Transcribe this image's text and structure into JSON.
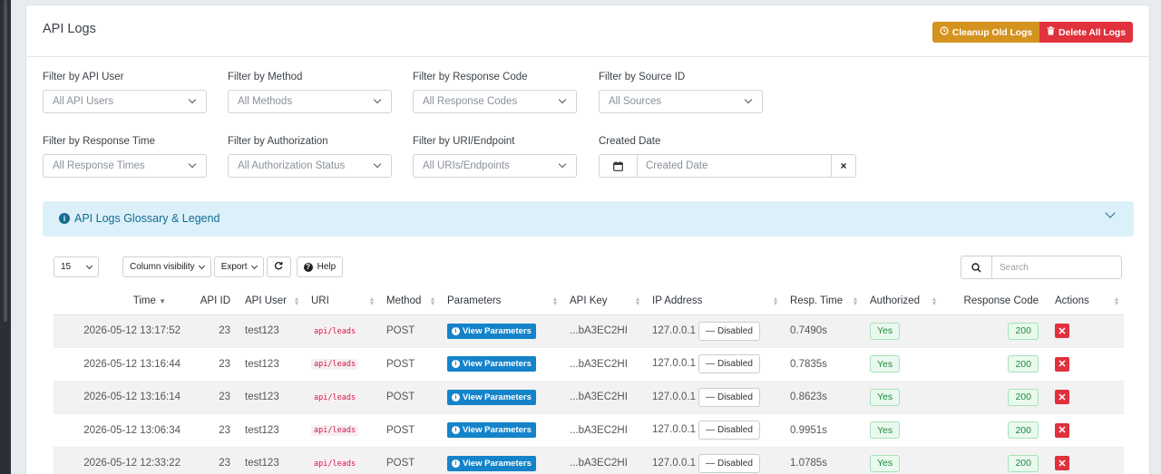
{
  "page": {
    "title": "API Logs",
    "cleanup_label": "Cleanup Old Logs",
    "delete_all_label": "Delete All Logs"
  },
  "filters": [
    {
      "label": "Filter by API User",
      "value": "All API Users"
    },
    {
      "label": "Filter by Method",
      "value": "All Methods"
    },
    {
      "label": "Filter by Response Code",
      "value": "All Response Codes"
    },
    {
      "label": "Filter by Source ID",
      "value": "All Sources"
    },
    {
      "label": "Filter by Response Time",
      "value": "All Response Times"
    },
    {
      "label": "Filter by Authorization",
      "value": "All Authorization Status"
    },
    {
      "label": "Filter by URI/Endpoint",
      "value": "All URIs/Endpoints"
    }
  ],
  "created_date": {
    "label": "Created Date",
    "placeholder": "Created Date",
    "clear": "×"
  },
  "glossary": {
    "title": "API Logs Glossary & Legend"
  },
  "toolbar": {
    "page_length": "15",
    "column_visibility": "Column visibility",
    "export": "Export",
    "help": "Help",
    "search_placeholder": "Search"
  },
  "table": {
    "columns": [
      "Time",
      "API ID",
      "API User",
      "URI",
      "Method",
      "Parameters",
      "API Key",
      "IP Address",
      "Resp. Time",
      "Authorized",
      "Response Code",
      "Actions"
    ],
    "rows": [
      {
        "time": "2026-05-12 13:17:52",
        "api_id": "23",
        "user": "test123",
        "uri": "api/leads",
        "method": "POST",
        "params": "View Parameters",
        "key": "...bA3EC2HI",
        "ip": "127.0.0.1",
        "ip_status": "Disabled",
        "resp_time": "0.7490s",
        "authorized": "Yes",
        "code": "200"
      },
      {
        "time": "2026-05-12 13:16:44",
        "api_id": "23",
        "user": "test123",
        "uri": "api/leads",
        "method": "POST",
        "params": "View Parameters",
        "key": "...bA3EC2HI",
        "ip": "127.0.0.1",
        "ip_status": "Disabled",
        "resp_time": "0.7835s",
        "authorized": "Yes",
        "code": "200"
      },
      {
        "time": "2026-05-12 13:16:14",
        "api_id": "23",
        "user": "test123",
        "uri": "api/leads",
        "method": "POST",
        "params": "View Parameters",
        "key": "...bA3EC2HI",
        "ip": "127.0.0.1",
        "ip_status": "Disabled",
        "resp_time": "0.8623s",
        "authorized": "Yes",
        "code": "200"
      },
      {
        "time": "2026-05-12 13:06:34",
        "api_id": "23",
        "user": "test123",
        "uri": "api/leads",
        "method": "POST",
        "params": "View Parameters",
        "key": "...bA3EC2HI",
        "ip": "127.0.0.1",
        "ip_status": "Disabled",
        "resp_time": "0.9951s",
        "authorized": "Yes",
        "code": "200"
      },
      {
        "time": "2026-05-12 12:33:22",
        "api_id": "23",
        "user": "test123",
        "uri": "api/leads",
        "method": "POST",
        "params": "View Parameters",
        "key": "...bA3EC2HI",
        "ip": "127.0.0.1",
        "ip_status": "Disabled",
        "resp_time": "1.0785s",
        "authorized": "Yes",
        "code": "200"
      }
    ]
  },
  "colors": {
    "warning": "#d4921f",
    "danger": "#e0313c",
    "info": "#1483c9",
    "success": "#1d8b3b"
  }
}
